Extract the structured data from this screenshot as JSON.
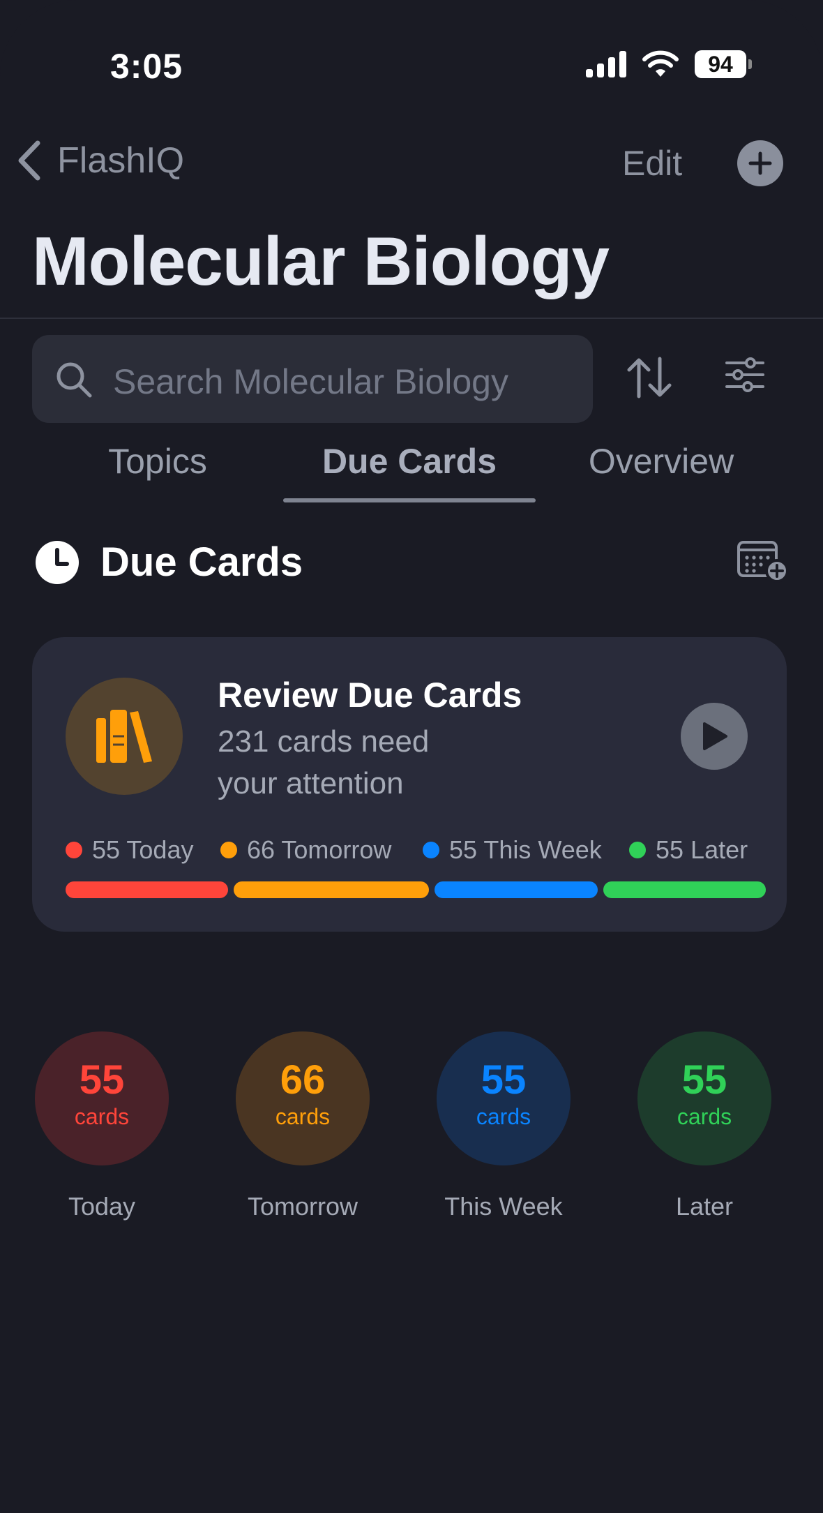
{
  "status_bar": {
    "time": "3:05",
    "battery": "94"
  },
  "nav": {
    "back_label": "FlashIQ",
    "edit_label": "Edit"
  },
  "page_title": "Molecular Biology",
  "search": {
    "placeholder": "Search Molecular Biology"
  },
  "tabs": [
    {
      "label": "Topics",
      "active": false
    },
    {
      "label": "Due Cards",
      "active": true
    },
    {
      "label": "Overview",
      "active": false
    }
  ],
  "section": {
    "title": "Due Cards",
    "icon": "clock-icon"
  },
  "review_card": {
    "title": "Review Due Cards",
    "subtitle": "231 cards need your attention",
    "icon": "books-icon",
    "legend": [
      {
        "label": "55 Today",
        "color": "#ff453a"
      },
      {
        "label": "66 Tomorrow",
        "color": "#ff9f0a"
      },
      {
        "label": "55 This Week",
        "color": "#0a84ff"
      },
      {
        "label": "55 Later",
        "color": "#30d158"
      }
    ],
    "progress": [
      {
        "value": 55,
        "color": "#ff453a"
      },
      {
        "value": 66,
        "color": "#ff9f0a"
      },
      {
        "value": 55,
        "color": "#0a84ff"
      },
      {
        "value": 55,
        "color": "#30d158"
      }
    ]
  },
  "stats": [
    {
      "count": "55",
      "unit": "cards",
      "label": "Today",
      "color": "#ff453a",
      "bg": "#4a2229"
    },
    {
      "count": "66",
      "unit": "cards",
      "label": "Tomorrow",
      "color": "#ff9f0a",
      "bg": "#4a3522"
    },
    {
      "count": "55",
      "unit": "cards",
      "label": "This Week",
      "color": "#0a84ff",
      "bg": "#182e4f"
    },
    {
      "count": "55",
      "unit": "cards",
      "label": "Later",
      "color": "#30d158",
      "bg": "#1d3c2c"
    }
  ]
}
